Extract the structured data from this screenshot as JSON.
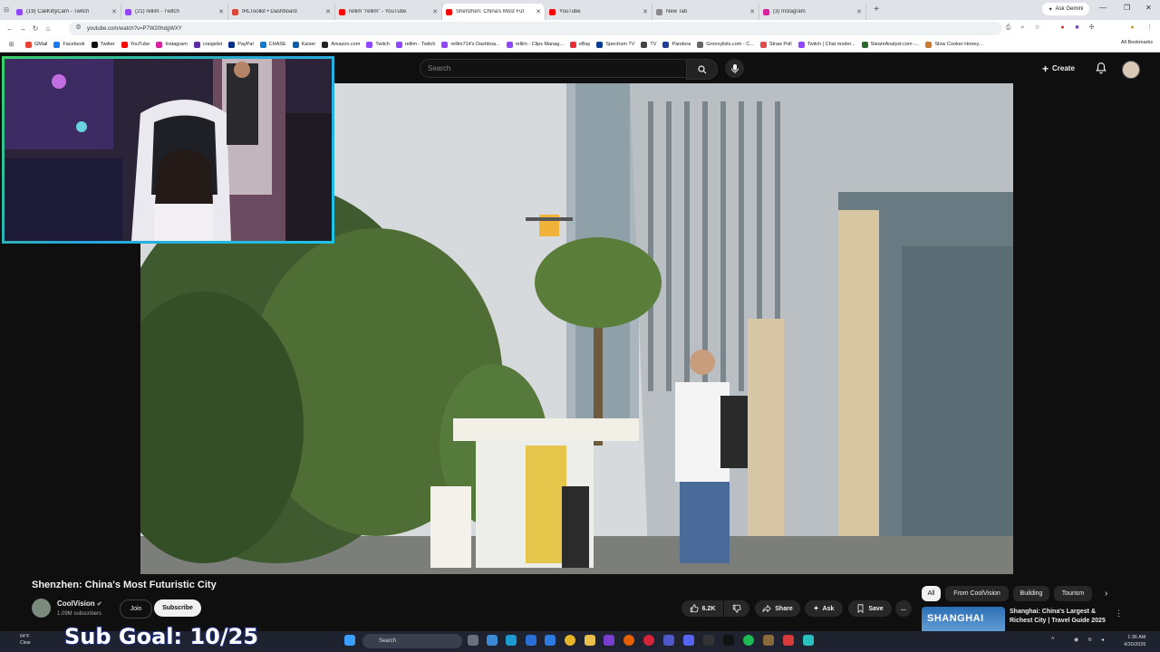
{
  "browser": {
    "tabs": [
      {
        "label": "(19) CaliKittyCam - Twitch",
        "color": "#9146ff"
      },
      {
        "label": "(21) rellim - Twitch",
        "color": "#9146ff"
      },
      {
        "label": "IRLToolkit • Dashboard",
        "color": "#e0453a"
      },
      {
        "label": "rellim \"rellim\" - YouTube",
        "color": "#ff0000"
      },
      {
        "label": "Shenzhen: China's Most Fut",
        "color": "#ff0000",
        "active": true
      },
      {
        "label": "YouTube",
        "color": "#ff0000"
      },
      {
        "label": "New Tab",
        "color": "#888888"
      },
      {
        "label": "(3) Instagram",
        "color": "#d6249f"
      }
    ],
    "new_tab": "+",
    "ask_gemini": "Ask Gemini",
    "url": "youtube.com/watch?v=P7W20hdgWXY",
    "bookmarks": [
      {
        "label": "GMail",
        "color": "#ea4335"
      },
      {
        "label": "Facebook",
        "color": "#1877f2"
      },
      {
        "label": "Twitter",
        "color": "#111111"
      },
      {
        "label": "YouTube",
        "color": "#ff0000"
      },
      {
        "label": "Instagram",
        "color": "#d6249f"
      },
      {
        "label": "craigslist",
        "color": "#5a2ca0"
      },
      {
        "label": "PayPal",
        "color": "#003087"
      },
      {
        "label": "CHASE",
        "color": "#117aca"
      },
      {
        "label": "Kaiser",
        "color": "#0a5ea8"
      },
      {
        "label": "Amazon.com",
        "color": "#222222"
      },
      {
        "label": "Twitch",
        "color": "#9146ff"
      },
      {
        "label": "rellim - Twitch",
        "color": "#9146ff"
      },
      {
        "label": "rellim714's Dashboa...",
        "color": "#9146ff"
      },
      {
        "label": "rellim - Clips Manag...",
        "color": "#9146ff"
      },
      {
        "label": "eBay",
        "color": "#e53238"
      },
      {
        "label": "Spectrum TV",
        "color": "#0a3d91"
      },
      {
        "label": "TV",
        "color": "#444444"
      },
      {
        "label": "Pandora",
        "color": "#224099"
      },
      {
        "label": "Groovylists.com - C...",
        "color": "#666666"
      },
      {
        "label": "Straw Poll",
        "color": "#e24b4b"
      },
      {
        "label": "Twitch | Chat moder...",
        "color": "#9146ff"
      },
      {
        "label": "SteamAnalyst.com -...",
        "color": "#2a6b2a"
      },
      {
        "label": "Slow Cooker Honey...",
        "color": "#c97b2e"
      }
    ],
    "all_bookmarks": "All Bookmarks"
  },
  "youtube": {
    "search_placeholder": "Search",
    "create_label": "Create",
    "video": {
      "title": "Shenzhen: China's Most Futuristic City",
      "channel": "CoolVision",
      "subscribers": "1.09M subscribers",
      "join": "Join",
      "subscribe": "Subscribe",
      "likes": "6.2K",
      "share": "Share",
      "ask": "Ask",
      "save": "Save",
      "more": "..."
    },
    "chips": [
      "All",
      "From CoolVision",
      "Building",
      "Tourism"
    ],
    "recommendation": {
      "thumb_text": "SHANGHAI",
      "title": "Shanghai: China's Largest & Richest City | Travel Guide 2025"
    }
  },
  "overlay": {
    "sub_goal": "Sub Goal: 10/25"
  },
  "taskbar": {
    "weather_temp": "64°F",
    "weather_desc": "Clear",
    "search": "Search",
    "time": "1:36 AM",
    "date": "4/20/2026"
  },
  "icons": {
    "search": "search-icon",
    "mic": "mic-icon",
    "bell": "bell-icon",
    "like": "thumbs-up-icon",
    "dislike": "thumbs-down-icon",
    "share": "share-icon",
    "ask": "sparkle-icon",
    "save": "bookmark-icon"
  }
}
